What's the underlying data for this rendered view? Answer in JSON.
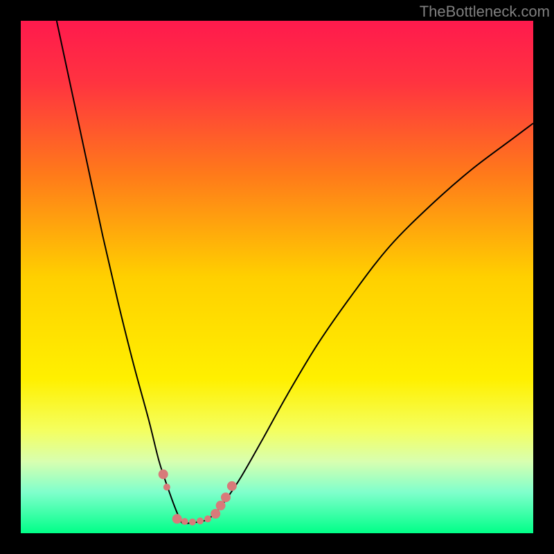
{
  "watermark": "TheBottleneck.com",
  "chart_data": {
    "type": "line",
    "title": "",
    "xlabel": "",
    "ylabel": "",
    "xlim": [
      0,
      100
    ],
    "ylim": [
      0,
      100
    ],
    "background_gradient": {
      "stops": [
        {
          "pct": 0,
          "color": "#ff1a4d"
        },
        {
          "pct": 12,
          "color": "#ff3340"
        },
        {
          "pct": 30,
          "color": "#ff7a1a"
        },
        {
          "pct": 50,
          "color": "#ffd000"
        },
        {
          "pct": 70,
          "color": "#fff000"
        },
        {
          "pct": 80,
          "color": "#f4ff60"
        },
        {
          "pct": 86,
          "color": "#d8ffb0"
        },
        {
          "pct": 92,
          "color": "#80ffcc"
        },
        {
          "pct": 100,
          "color": "#00ff88"
        }
      ]
    },
    "series": [
      {
        "name": "curve",
        "color": "#000000",
        "width": 2,
        "x": [
          7,
          10,
          13,
          16,
          19,
          22,
          25,
          27,
          29,
          30.5,
          31.5,
          33,
          36,
          38,
          40,
          43,
          47,
          52,
          58,
          65,
          72,
          80,
          88,
          96,
          100
        ],
        "y": [
          100,
          86,
          72,
          58,
          45,
          33,
          22,
          14,
          8,
          4,
          2,
          2,
          2.5,
          4,
          6.5,
          11,
          18,
          27,
          37,
          47,
          56,
          64,
          71,
          77,
          80
        ]
      }
    ],
    "markers": {
      "name": "bottom-markers",
      "color": "#d87a7a",
      "radius_primary": 7,
      "radius_secondary": 5,
      "points": [
        {
          "x": 27.8,
          "y": 11.5,
          "r": "primary"
        },
        {
          "x": 28.5,
          "y": 9.0,
          "r": "secondary"
        },
        {
          "x": 30.5,
          "y": 2.8,
          "r": "primary"
        },
        {
          "x": 32.0,
          "y": 2.3,
          "r": "secondary"
        },
        {
          "x": 33.5,
          "y": 2.2,
          "r": "secondary"
        },
        {
          "x": 35.0,
          "y": 2.4,
          "r": "secondary"
        },
        {
          "x": 36.5,
          "y": 2.8,
          "r": "secondary"
        },
        {
          "x": 38.0,
          "y": 3.8,
          "r": "primary"
        },
        {
          "x": 39.0,
          "y": 5.4,
          "r": "primary"
        },
        {
          "x": 40.0,
          "y": 7.0,
          "r": "primary"
        },
        {
          "x": 41.2,
          "y": 9.2,
          "r": "primary"
        }
      ]
    }
  }
}
